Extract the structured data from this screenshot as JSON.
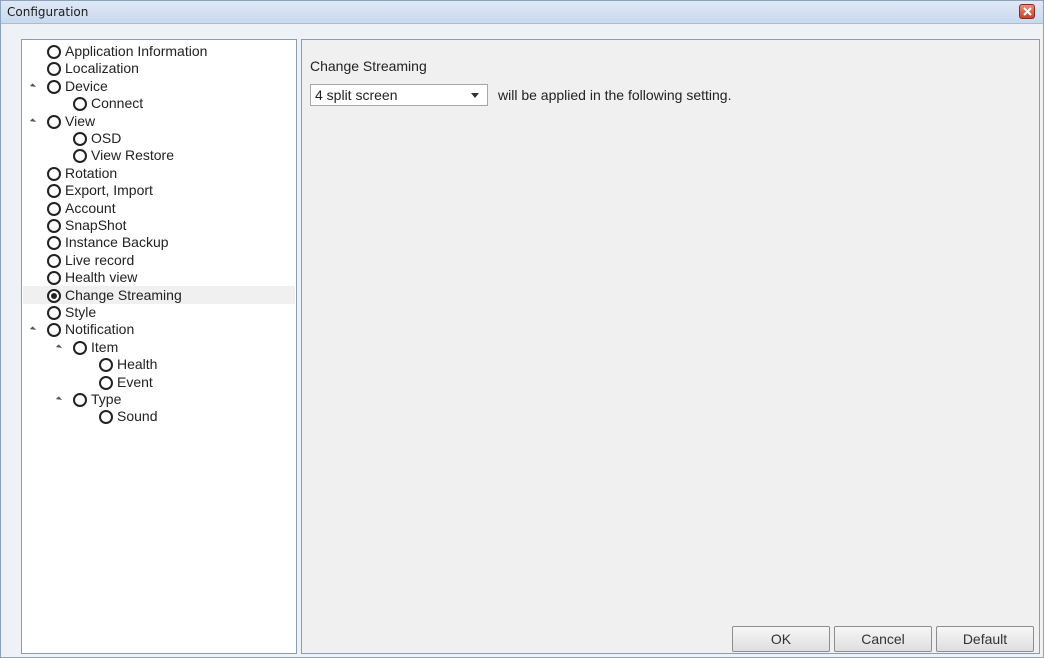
{
  "window": {
    "title": "Configuration"
  },
  "tree": [
    {
      "label": "Application Information",
      "level": 0,
      "expander": false,
      "checked": false
    },
    {
      "label": "Localization",
      "level": 0,
      "expander": false,
      "checked": false
    },
    {
      "label": "Device",
      "level": 0,
      "expander": true,
      "checked": false
    },
    {
      "label": "Connect",
      "level": 1,
      "expander": false,
      "checked": false
    },
    {
      "label": "View",
      "level": 0,
      "expander": true,
      "checked": false
    },
    {
      "label": "OSD",
      "level": 1,
      "expander": false,
      "checked": false
    },
    {
      "label": "View Restore",
      "level": 1,
      "expander": false,
      "checked": false
    },
    {
      "label": "Rotation",
      "level": 0,
      "expander": false,
      "checked": false
    },
    {
      "label": "Export, Import",
      "level": 0,
      "expander": false,
      "checked": false
    },
    {
      "label": "Account",
      "level": 0,
      "expander": false,
      "checked": false
    },
    {
      "label": "SnapShot",
      "level": 0,
      "expander": false,
      "checked": false
    },
    {
      "label": "Instance Backup",
      "level": 0,
      "expander": false,
      "checked": false
    },
    {
      "label": "Live record",
      "level": 0,
      "expander": false,
      "checked": false
    },
    {
      "label": "Health view",
      "level": 0,
      "expander": false,
      "checked": false
    },
    {
      "label": "Change Streaming",
      "level": 0,
      "expander": false,
      "checked": true,
      "selected": true
    },
    {
      "label": "Style",
      "level": 0,
      "expander": false,
      "checked": false
    },
    {
      "label": "Notification",
      "level": 0,
      "expander": true,
      "checked": false
    },
    {
      "label": "Item",
      "level": 1,
      "expander": true,
      "checked": false
    },
    {
      "label": "Health",
      "level": 2,
      "expander": false,
      "checked": false
    },
    {
      "label": "Event",
      "level": 2,
      "expander": false,
      "checked": false
    },
    {
      "label": "Type",
      "level": 1,
      "expander": true,
      "checked": false
    },
    {
      "label": "Sound",
      "level": 2,
      "expander": false,
      "checked": false
    }
  ],
  "content": {
    "section_title": "Change Streaming",
    "select_value": "4 split screen",
    "apply_text": "will be applied in the following setting."
  },
  "buttons": {
    "ok": "OK",
    "cancel": "Cancel",
    "default": "Default"
  }
}
